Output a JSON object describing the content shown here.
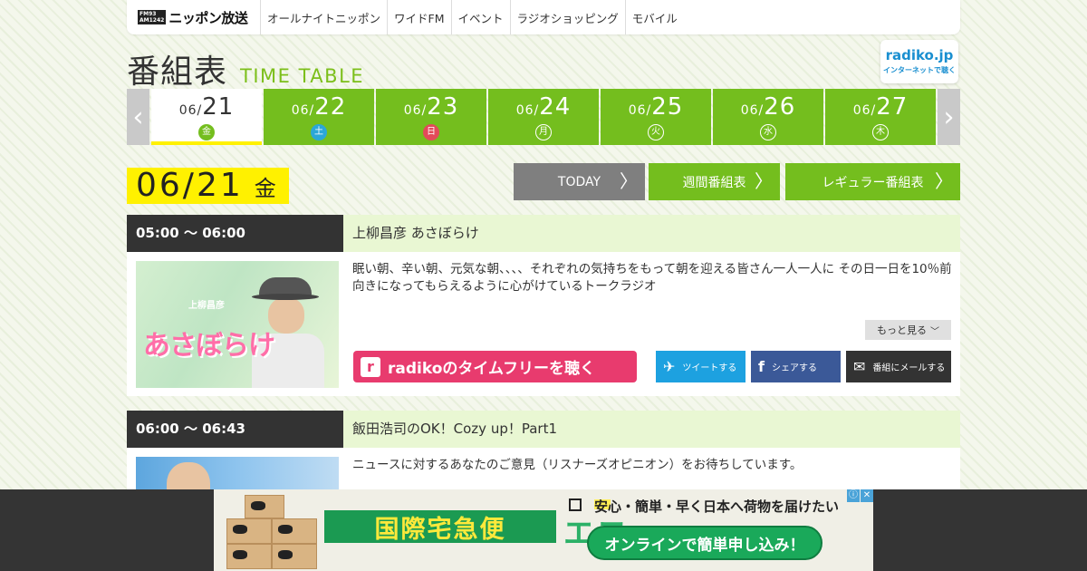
{
  "nav": {
    "logo_badge_1": "FM93",
    "logo_badge_2": "AM1242",
    "logo_name": "ニッポン放送",
    "items": [
      "オールナイトニッポン",
      "ワイドFM",
      "イベント",
      "ラジオショッピング",
      "モバイル"
    ]
  },
  "header": {
    "title_jp": "番組表",
    "title_en": "TIME TABLE",
    "radiko_logo": "radiko.jp",
    "radiko_sub": "インターネットで聴く"
  },
  "tabs": {
    "prev": "‹",
    "next": "›",
    "dates": [
      {
        "month": "06/",
        "day": "21",
        "weekday": "金",
        "active": true
      },
      {
        "month": "06/",
        "day": "22",
        "weekday": "土"
      },
      {
        "month": "06/",
        "day": "23",
        "weekday": "日"
      },
      {
        "month": "06/",
        "day": "24",
        "weekday": "月"
      },
      {
        "month": "06/",
        "day": "25",
        "weekday": "火"
      },
      {
        "month": "06/",
        "day": "26",
        "weekday": "水"
      },
      {
        "month": "06/",
        "day": "27",
        "weekday": "木"
      }
    ]
  },
  "current": {
    "date": "06/21",
    "weekday": "金"
  },
  "buttons": {
    "today": "TODAY",
    "weekly": "週間番組表",
    "regular": "レギュラー番組表",
    "chevron": "〉"
  },
  "programs": [
    {
      "time": "05:00 ～ 06:00",
      "title": "上柳昌彦 あさぼらけ",
      "description": "眠い朝、辛い朝、元気な朝、、、、それぞれの気持ちをもって朝を迎える皆さん一人一人に その日一日を10％前向きになってもらえるように心がけているトークラジオ",
      "thumb_text": "あさぼらけ",
      "thumb_small": "上柳昌彦",
      "more": "もっと見る",
      "radiko_label": "radikoのタイムフリーを聴く",
      "tweet": "ツイートする",
      "share": "シェアする",
      "mail": "番組にメールする"
    },
    {
      "time": "06:00 ～ 06:43",
      "title": "飯田浩司のOK！Cozy up！Part1",
      "description": "ニュースに対するあなたのご意見（リスナーズオピニオン）をお待ちしています。"
    }
  ],
  "ad": {
    "headline": "安心・簡単・早く日本へ荷物を届けたい",
    "main": "国際宅急便",
    "eco": "エコ",
    "cta": "オンラインで簡単申し込み！",
    "info": "ⓘ",
    "close": "✕"
  },
  "colors": {
    "green": "#74be1e",
    "yellow": "#fff100",
    "radiko_pink": "#e83b6e",
    "twitter": "#1da1e0",
    "facebook": "#3b5998"
  }
}
